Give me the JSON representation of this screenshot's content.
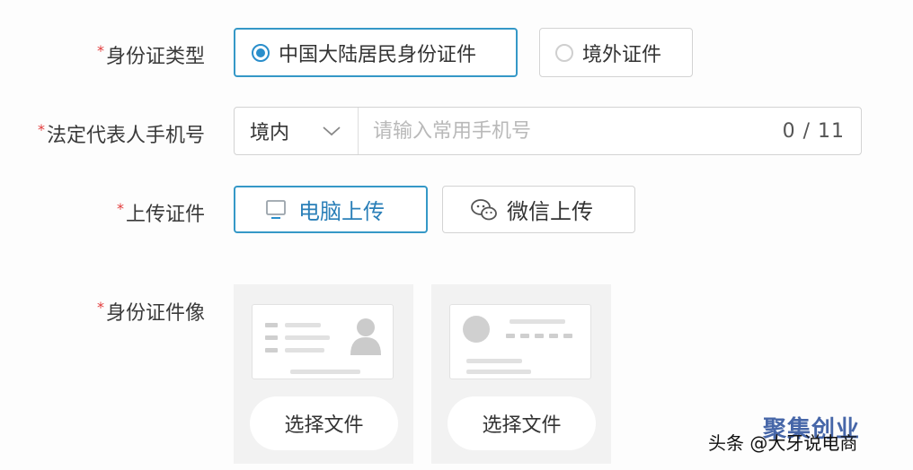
{
  "form": {
    "id_type": {
      "required_mark": "*",
      "label": "身份证类型",
      "options": [
        {
          "label": "中国大陆居民身份证件",
          "selected": true
        },
        {
          "label": "境外证件",
          "selected": false
        }
      ]
    },
    "phone": {
      "required_mark": "*",
      "label": "法定代表人手机号",
      "region": "境内",
      "placeholder": "请输入常用手机号",
      "counter": "0 / 11"
    },
    "upload": {
      "required_mark": "*",
      "label": "上传证件",
      "pc_label": "电脑上传",
      "wechat_label": "微信上传"
    },
    "id_images": {
      "required_mark": "*",
      "label": "身份证件像",
      "front_button": "选择文件",
      "back_button": "选择文件"
    }
  },
  "watermark": {
    "text": "头条 @大牙说电商",
    "brand": "聚集创业"
  },
  "colors": {
    "accent": "#2a8ecb",
    "required": "#e23b3b",
    "brand": "#4666a8"
  },
  "icons": [
    "radio-checked-icon",
    "radio-unchecked-icon",
    "chevron-down-icon",
    "monitor-icon",
    "wechat-icon",
    "avatar-silhouette-icon"
  ]
}
